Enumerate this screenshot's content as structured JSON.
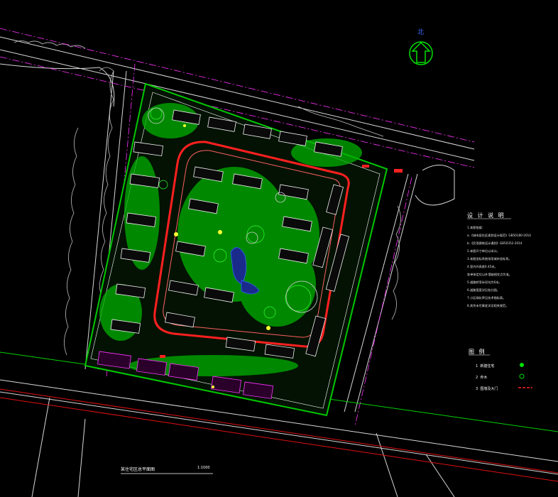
{
  "north_label": "北",
  "drawing_title": "某住宅区总平面图",
  "drawing_scale": "1:1000",
  "notes": {
    "title": "设 计 说 明",
    "lines": [
      "1.本图依据:",
      "  a.《城市居住区规划设计规范》GB50180-2014",
      "  b.《民用建筑设计通则》GB50352-2014",
      "2.本图尺寸单位以米计。",
      "3.本图坐标系统采用城市坐标系。",
      "4.室内外高差0.45米。",
      "  各单体定位以外墙轴线交点为准。",
      "5.道路转弯半径均为6米。",
      "6.道路宽度详见各分图。",
      "7.小区绿化率见技术指标表。",
      "8.其余未尽事宜详见相关规范。"
    ]
  },
  "legend": {
    "title": "图 例",
    "items": [
      {
        "num": "1",
        "label": "新建住宅"
      },
      {
        "num": "2",
        "label": "乔木"
      },
      {
        "num": "3",
        "label": "围墙及大门"
      }
    ]
  },
  "colors": {
    "background": "#000000",
    "road_line": "#ffffff",
    "boundary": "#ff33ff",
    "green": "#00e000",
    "red_road": "#ff2020",
    "blue": "#3060ff",
    "yellow": "#ffff33"
  }
}
